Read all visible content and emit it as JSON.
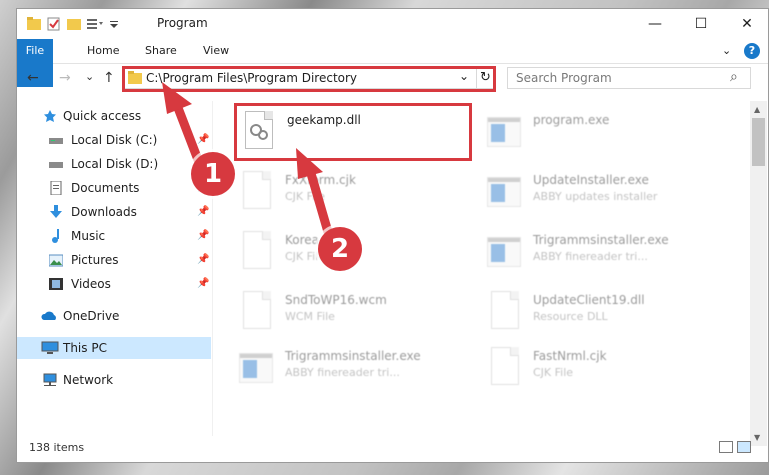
{
  "window": {
    "title": "Program",
    "min_label": "—",
    "max_label": "☐",
    "close_label": "✕"
  },
  "ribbon": {
    "tabs": [
      "File",
      "Home",
      "Share",
      "View"
    ],
    "expand_label": "⌄",
    "help_label": "?"
  },
  "address": {
    "path": "C:\\Program Files\\Program Directory",
    "back_label": "←",
    "forward_label": "→",
    "recent_label": "⌄",
    "up_label": "↑",
    "dropdown_label": "⌄",
    "refresh_label": "↻"
  },
  "search": {
    "placeholder": "Search Program",
    "icon_label": "⌕"
  },
  "sidebar": {
    "items": [
      {
        "label": "Quick access"
      },
      {
        "label": "Local Disk (C:)"
      },
      {
        "label": "Local Disk (D:)"
      },
      {
        "label": "Documents"
      },
      {
        "label": "Downloads"
      },
      {
        "label": "Music"
      },
      {
        "label": "Pictures"
      },
      {
        "label": "Videos"
      },
      {
        "label": "OneDrive"
      },
      {
        "label": "This PC"
      },
      {
        "label": "Network"
      }
    ],
    "pin_label": "📌"
  },
  "files": {
    "highlighted": {
      "name": "geekamp.dll"
    },
    "items": [
      {
        "name": "program.exe",
        "type": ""
      },
      {
        "name": "FxXform.cjk",
        "type": "CJK File"
      },
      {
        "name": "UpdateInstaller.exe",
        "type": "ABBY updates installer"
      },
      {
        "name": "Korea...",
        "type": "CJK File"
      },
      {
        "name": "Trigrammsinstaller.exe",
        "type": "ABBY finereader tri..."
      },
      {
        "name": "SndToWP16.wcm",
        "type": "WCM File"
      },
      {
        "name": "UpdateClient19.dll",
        "type": "Resource DLL"
      },
      {
        "name": "Trigrammsinstaller.exe",
        "type": "ABBY finereader tri..."
      },
      {
        "name": "FastNrml.cjk",
        "type": "CJK File"
      }
    ]
  },
  "status": {
    "count": "138 items"
  },
  "annotations": {
    "step1": "1",
    "step2": "2"
  },
  "colors": {
    "accent": "#1979ca",
    "highlight": "#d7393f",
    "selection": "#cce8ff"
  }
}
